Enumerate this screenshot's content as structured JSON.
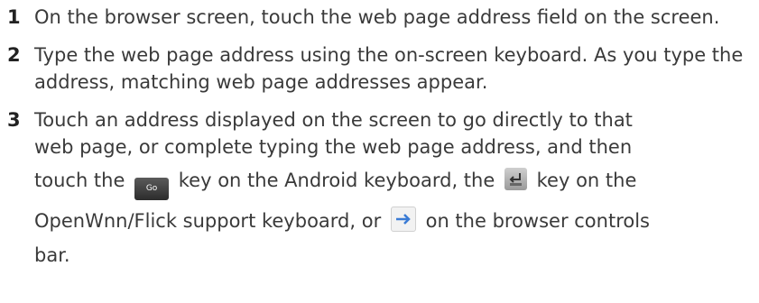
{
  "steps": [
    {
      "number": "1",
      "text": "On the browser screen, touch the web page address field on the screen."
    },
    {
      "number": "2",
      "text": "Type the web page address using the on-screen keyboard. As you type the address, matching web page addresses appear."
    },
    {
      "number": "3",
      "line1": "Touch an address displayed on the screen to go directly to that",
      "line2": "web page, or complete typing the web page address, and then",
      "line3_a": "touch the",
      "go_key_label": "Go",
      "line3_b": "key on the Android keyboard, the",
      "line3_c": "key on the",
      "line4_a": "OpenWnn/Flick support keyboard, or",
      "line4_b": "on the browser controls",
      "line5": "bar."
    }
  ],
  "icons": {
    "go_key": "go-key-icon",
    "enter_key": "enter-key-icon",
    "arrow": "right-arrow-icon"
  },
  "colors": {
    "text": "#3a3a3a",
    "number": "#222222",
    "go_key_bg": "#3a3a3a",
    "arrow": "#3a7bd5"
  }
}
